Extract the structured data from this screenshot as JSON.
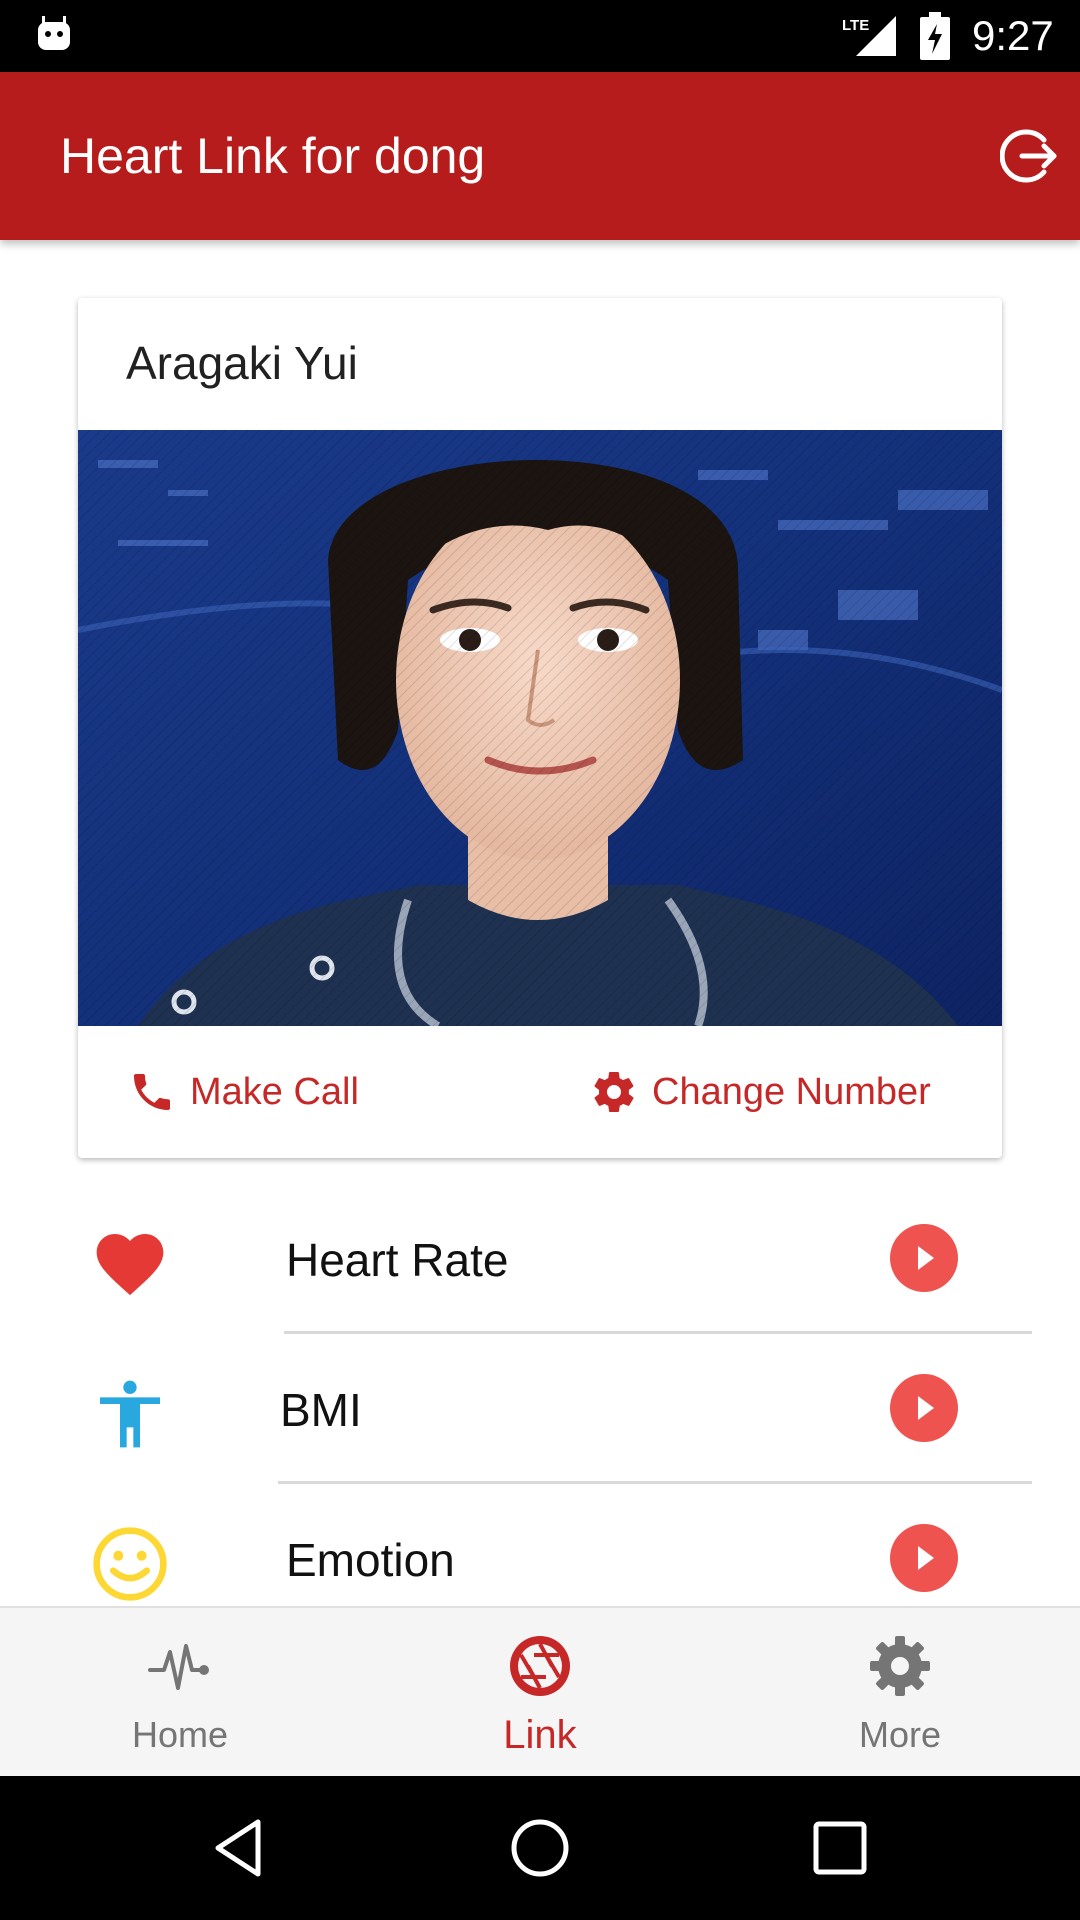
{
  "status_bar": {
    "network": "LTE",
    "time": "9:27"
  },
  "app_bar": {
    "title": "Heart Link for dong",
    "logout_icon": "logout-icon"
  },
  "contact_card": {
    "name": "Aragaki Yui",
    "photo_icon": "contact-photo",
    "actions": {
      "call_label": "Make Call",
      "change_label": "Change Number"
    }
  },
  "list": {
    "items": [
      {
        "label": "Heart Rate",
        "icon": "heart-icon",
        "icon_color": "#e53935"
      },
      {
        "label": "BMI",
        "icon": "accessibility-icon",
        "icon_color": "#29a8e0"
      },
      {
        "label": "Emotion",
        "icon": "smiley-icon",
        "icon_color": "#fdd835"
      }
    ],
    "go_button_color": "#ef5350"
  },
  "bottom_nav": {
    "items": [
      {
        "label": "Home",
        "icon": "heartbeat-icon"
      },
      {
        "label": "Link",
        "icon": "aperture-icon",
        "active": true
      },
      {
        "label": "More",
        "icon": "gear-icon"
      }
    ]
  },
  "colors": {
    "primary": "#b71c1c",
    "accent": "#c62828",
    "inactive": "#757575"
  }
}
